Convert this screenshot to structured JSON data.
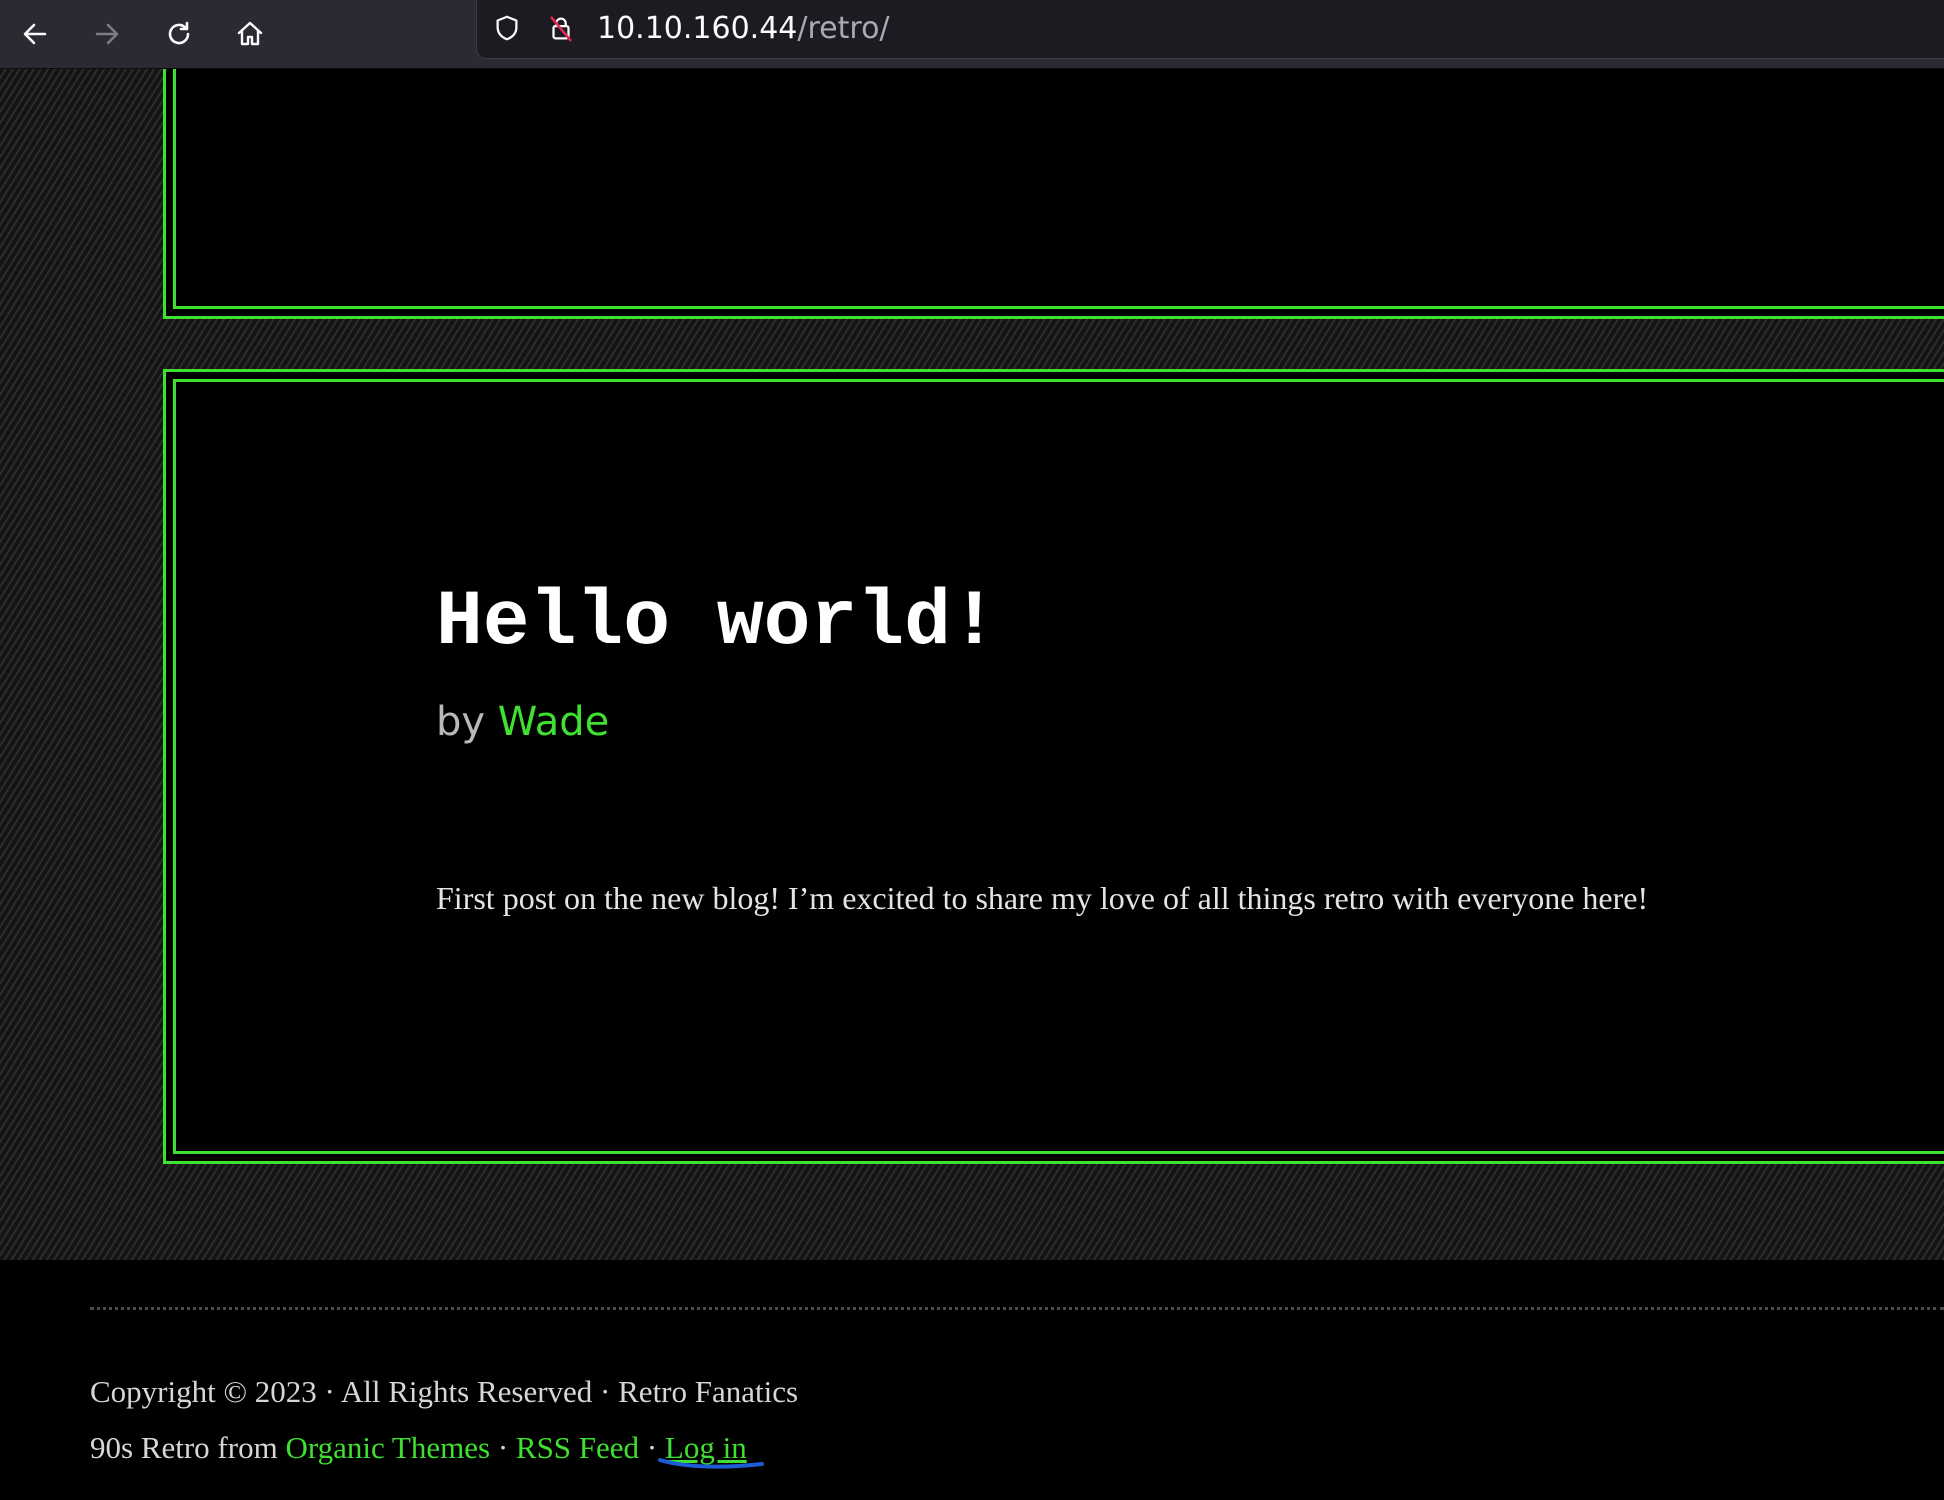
{
  "browser": {
    "url_host": "10.10.160.44",
    "url_path": "/retro/"
  },
  "post": {
    "title": "Hello world!",
    "by_prefix": "by",
    "author": "Wade",
    "body": "First post on the new blog! I’m excited to share my love of all things retro with everyone here!"
  },
  "footer": {
    "copyright": "Copyright © 2023 · All Rights Reserved · Retro Fanatics",
    "theme_prefix": "90s Retro from",
    "theme_link": "Organic Themes",
    "sep1": "·",
    "rss_link": "RSS Feed",
    "sep2": "·",
    "login_link": "Log in"
  },
  "colors": {
    "accent": "#3fe02f",
    "annotation": "#1e5bd6"
  }
}
